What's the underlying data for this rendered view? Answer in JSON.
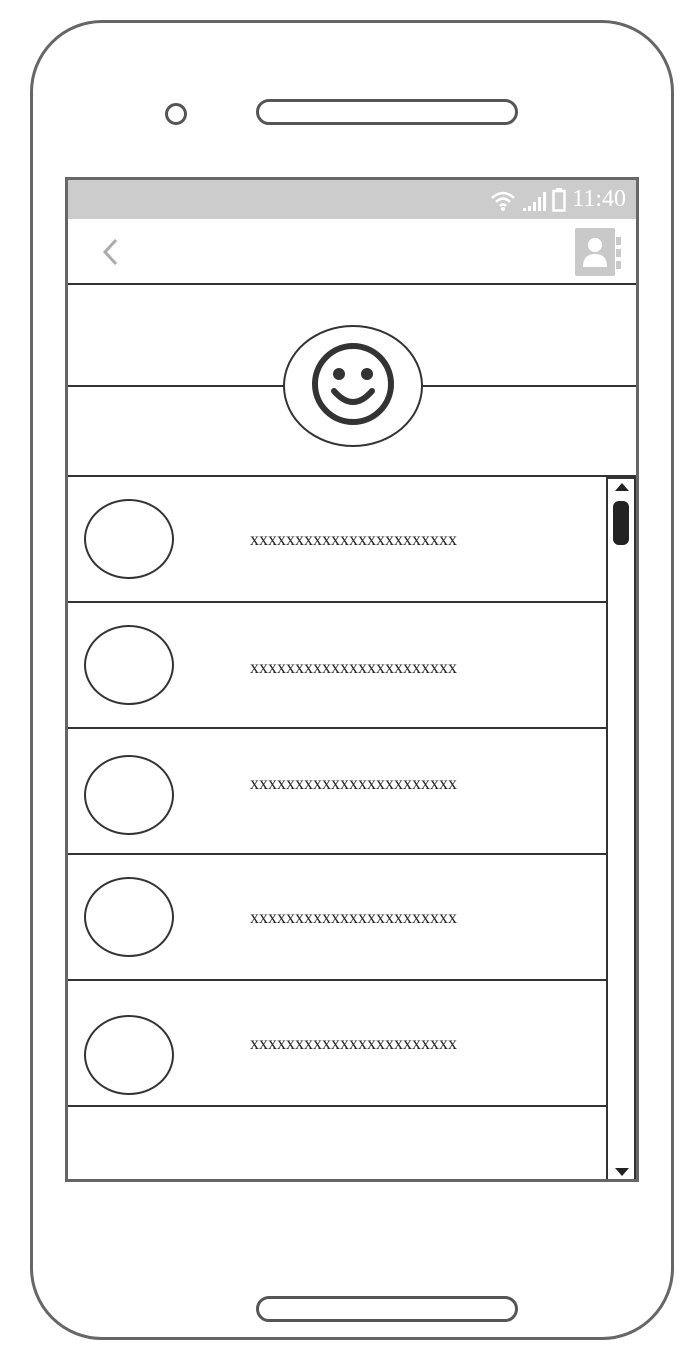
{
  "status_bar": {
    "time": "11:40",
    "icons": [
      "wifi-icon",
      "signal-icon",
      "battery-icon"
    ]
  },
  "nav_bar": {
    "back_icon": "chevron-left-icon",
    "contacts_icon": "contact-book-icon"
  },
  "profile": {
    "avatar_icon": "smiley-face-icon"
  },
  "list": {
    "items": [
      {
        "text": "xxxxxxxxxxxxxxxxxxxxxxx"
      },
      {
        "text": "xxxxxxxxxxxxxxxxxxxxxxx"
      },
      {
        "text": "xxxxxxxxxxxxxxxxxxxxxxx"
      },
      {
        "text": "xxxxxxxxxxxxxxxxxxxxxxx"
      },
      {
        "text": "xxxxxxxxxxxxxxxxxxxxxxx"
      }
    ]
  },
  "colors": {
    "status_bar_bg": "#cccccc",
    "outline": "#333333",
    "frame": "#666666"
  }
}
